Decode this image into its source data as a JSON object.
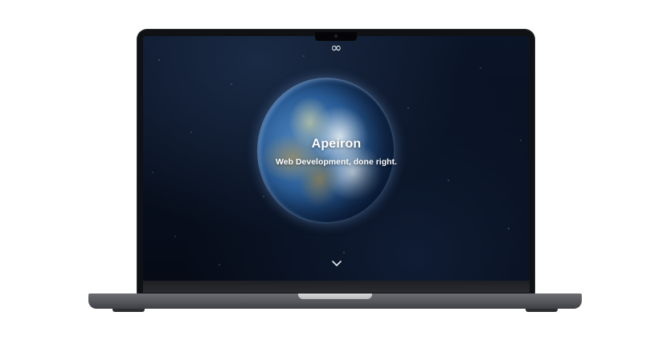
{
  "site": {
    "logo_symbol": "∞",
    "title": "Apeiron",
    "subtitle": "Web Development, done right."
  },
  "icons": {
    "logo": "infinity-icon",
    "scroll": "chevron-down-icon"
  },
  "colors": {
    "screen_background": "#08101f",
    "text": "#ffffff",
    "laptop_body": "#55565b"
  }
}
